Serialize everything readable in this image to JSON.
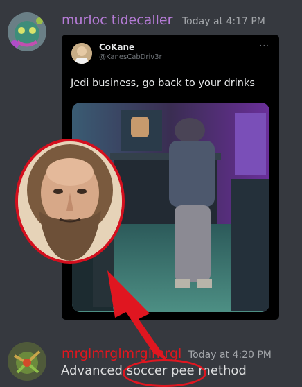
{
  "messages": [
    {
      "username": "murloc tidecaller",
      "username_color": "#b57bd6",
      "timestamp": "Today at 4:17 PM",
      "avatar_icon": "murloc-avatar-icon",
      "embed": {
        "author_name": "CoKane",
        "author_handle": "@KanesCabDriv3r",
        "more_icon": "more-horizontal-icon",
        "more_glyph": "···",
        "text": "Jedi business, go back to your drinks",
        "media": "nightclub-photo"
      }
    },
    {
      "username": "mrglmrglmrglmrgl",
      "username_color": "#e1161e",
      "timestamp": "Today at 4:20 PM",
      "avatar_icon": "plant-creature-avatar-icon",
      "text": "Advanced soccer pee method"
    }
  ],
  "overlay": {
    "portrait": "bearded-philosopher-portrait",
    "accent_color": "#d40f1e"
  }
}
